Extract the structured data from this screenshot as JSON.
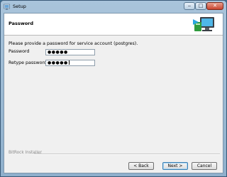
{
  "window": {
    "title": "Setup"
  },
  "header": {
    "title": "Password"
  },
  "main": {
    "description": "Please provide a password for service account (postgres).",
    "fields": [
      {
        "label": "Password",
        "value": "●●●●●"
      },
      {
        "label": "Retype password",
        "value": "●●●●●"
      }
    ]
  },
  "footer": {
    "brand": "BitRock Installer",
    "back_label": "< Back",
    "next_label": "Next >",
    "cancel_label": "Cancel"
  },
  "colors": {
    "window_frame": "#8fb0cc",
    "close_button": "#c8442f",
    "desktop": "#3d6f93"
  },
  "icons": [
    "setup-app-icon",
    "minimize-icon",
    "maximize-icon",
    "close-icon",
    "computer-install-icon"
  ]
}
